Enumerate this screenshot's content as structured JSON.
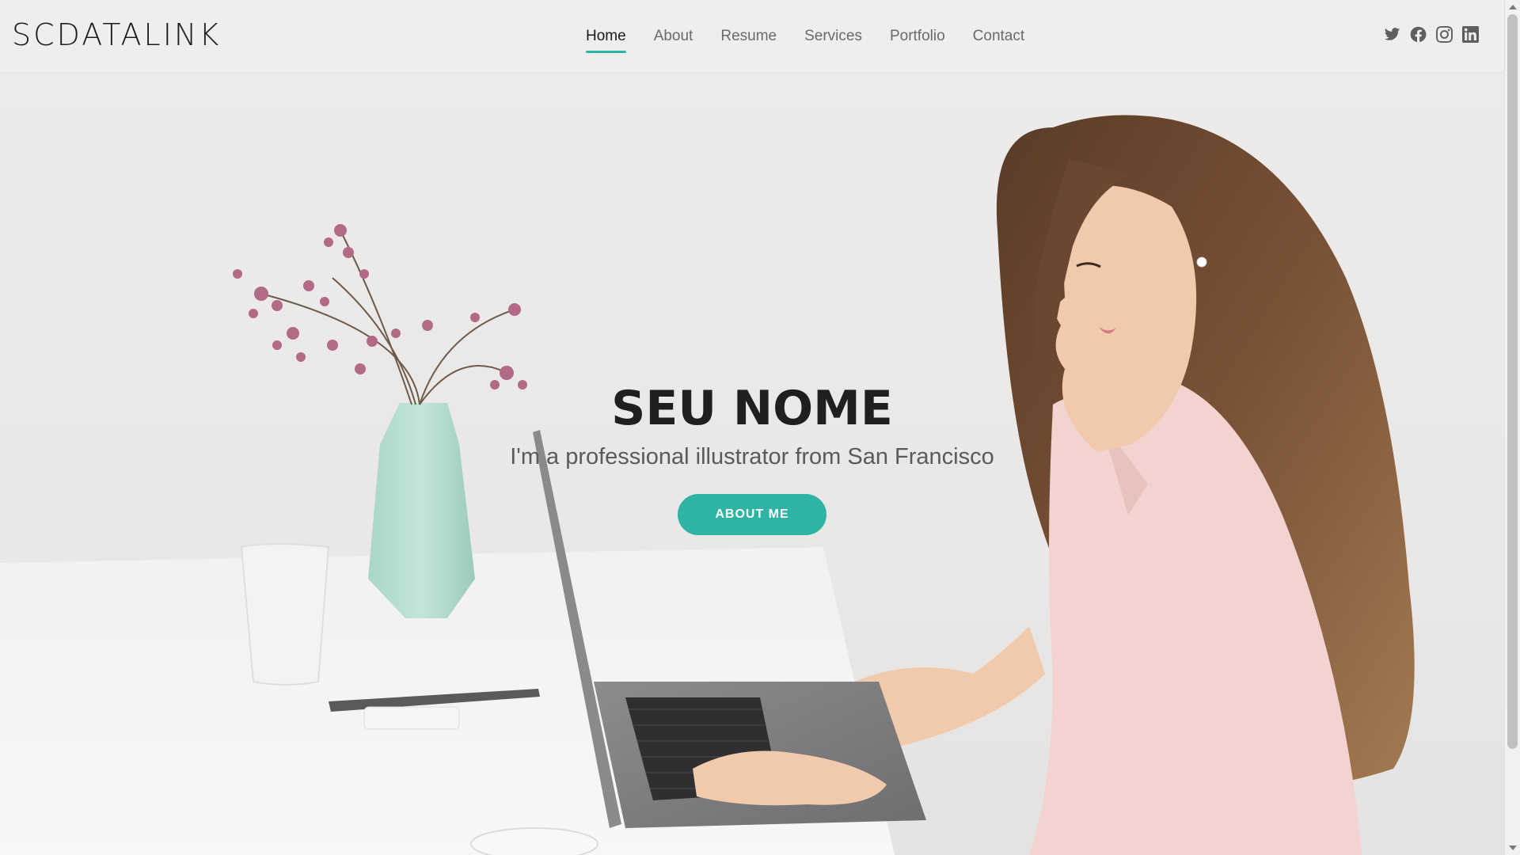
{
  "header": {
    "logo": "SCDATALINK",
    "nav": [
      {
        "label": "Home",
        "active": true
      },
      {
        "label": "About",
        "active": false
      },
      {
        "label": "Resume",
        "active": false
      },
      {
        "label": "Services",
        "active": false
      },
      {
        "label": "Portfolio",
        "active": false
      },
      {
        "label": "Contact",
        "active": false
      }
    ],
    "social_icons": [
      "twitter-icon",
      "facebook-icon",
      "instagram-icon",
      "linkedin-icon"
    ]
  },
  "hero": {
    "title": "SEU NOME",
    "subtitle": "I'm a professional illustrator from San Francisco",
    "button_label": "ABOUT ME"
  },
  "colors": {
    "accent": "#2fb3a3",
    "title": "#1f1f1f",
    "nav_text": "#6a6a6a",
    "background": "#ebeae9"
  }
}
